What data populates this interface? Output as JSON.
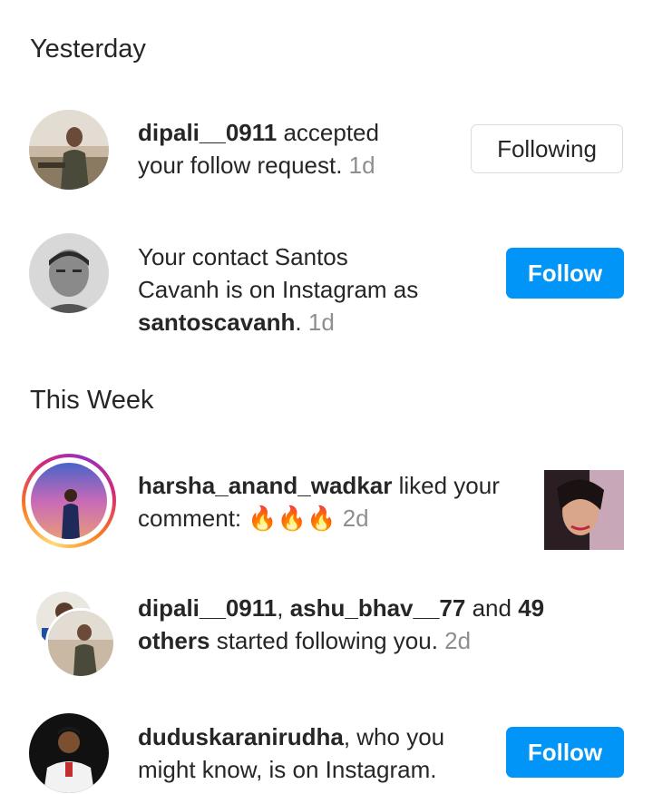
{
  "sections": {
    "yesterday": "Yesterday",
    "this_week": "This Week"
  },
  "notifications": [
    {
      "user": "dipali__0911",
      "text_a": " accepted",
      "text_b": "your follow request.",
      "time": " 1d",
      "button": "Following"
    },
    {
      "line1": "Your contact Santos",
      "line2": "Cavanh is on Instagram as",
      "user": "santoscavanh",
      "punct": ".",
      "time": " 1d",
      "button": "Follow"
    },
    {
      "user": "harsha_anand_wadkar",
      "text_a": " liked your",
      "text_b": "comment: ",
      "emoji": "🔥🔥🔥",
      "time": " 2d"
    },
    {
      "user1": "dipali__0911",
      "sep": ", ",
      "user2": "ashu_bhav__77",
      "and": " and ",
      "count": "49",
      "others": "others",
      "text": " started following you.",
      "time": " 2d"
    },
    {
      "user": "duduskaranirudha",
      "text_a": ", who you",
      "text_b": "might know, is on Instagram.",
      "button": "Follow"
    }
  ],
  "colors": {
    "follow_button": "#0095f6",
    "text": "#262626",
    "timestamp": "#8e8e8e"
  }
}
